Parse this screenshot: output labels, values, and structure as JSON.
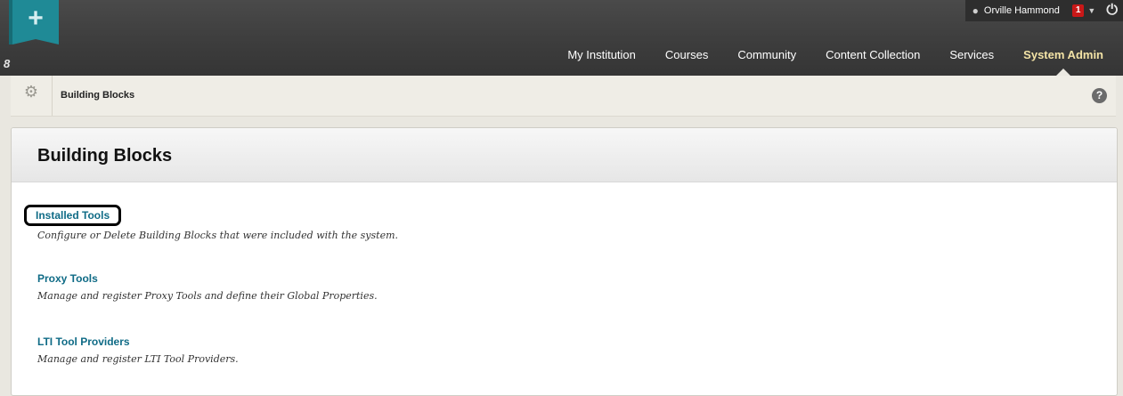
{
  "header": {
    "brand_icon": "plus",
    "user_name": "Orville Hammond",
    "notification_count": "1",
    "nav": [
      {
        "label": "My Institution"
      },
      {
        "label": "Courses"
      },
      {
        "label": "Community"
      },
      {
        "label": "Content Collection"
      },
      {
        "label": "Services"
      },
      {
        "label": "System Admin",
        "active": true
      }
    ]
  },
  "breadcrumb": {
    "current": "Building Blocks"
  },
  "page": {
    "title": "Building Blocks",
    "items": [
      {
        "label": "Installed Tools",
        "description": "Configure or Delete Building Blocks that were included with the system."
      },
      {
        "label": "Proxy Tools",
        "description": "Manage and register Proxy Tools and define their Global Properties."
      },
      {
        "label": "LTI Tool Providers",
        "description": "Manage and register LTI Tool Providers."
      }
    ]
  },
  "colors": {
    "header_bg": "#3c3c3c",
    "brand": "#1f8a96",
    "link": "#0f6b86",
    "active_nav": "#f3e3a6",
    "badge": "#c91818"
  }
}
